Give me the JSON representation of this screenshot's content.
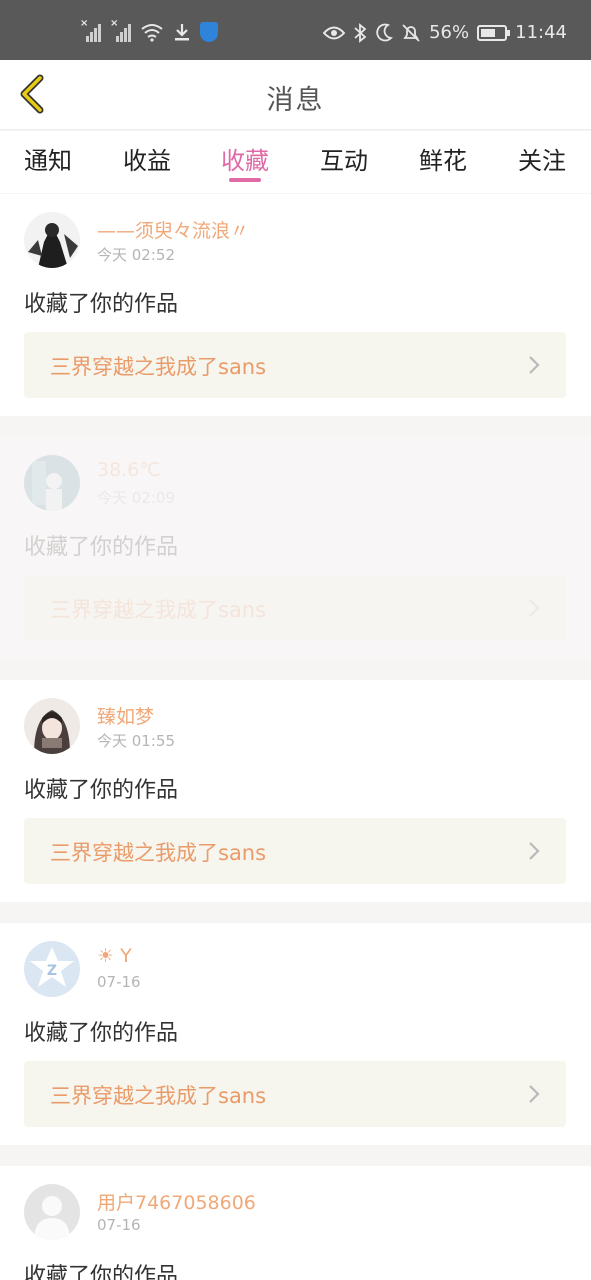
{
  "status_bar": {
    "battery": "56%",
    "time": "11:44",
    "icons": [
      "signal-1-icon",
      "signal-2-icon",
      "wifi-icon",
      "download-icon",
      "shield-icon",
      "eye-icon",
      "bluetooth-icon",
      "moon-icon",
      "bell-off-icon",
      "battery-icon"
    ]
  },
  "header": {
    "title": "消息",
    "back_icon": "chevron-left-icon",
    "accent": "#e0c400"
  },
  "tabs": [
    {
      "label": "通知"
    },
    {
      "label": "收益"
    },
    {
      "label": "收藏",
      "active": true
    },
    {
      "label": "互动"
    },
    {
      "label": "鲜花"
    },
    {
      "label": "关注"
    }
  ],
  "colors": {
    "accent": "#e06aa6",
    "username": "#f0a878",
    "work_title": "#ea9b6a",
    "work_bg": "#f6f5ee"
  },
  "items": [
    {
      "username": "——须臾々流浪〃",
      "time": "今天 02:52",
      "action": "收藏了你的作品",
      "work": "三界穿越之我成了sans"
    },
    {
      "username": "38.6℃",
      "time": "今天 02:09",
      "action": "收藏了你的作品",
      "work": "三界穿越之我成了sans"
    },
    {
      "username": "臻如梦",
      "time": "今天 01:55",
      "action": "收藏了你的作品",
      "work": "三界穿越之我成了sans"
    },
    {
      "username": "☀ Y",
      "time": "07-16",
      "action": "收藏了你的作品",
      "work": "三界穿越之我成了sans"
    },
    {
      "username": "用户7467058606",
      "time": "07-16",
      "action": "收藏了你的作品",
      "work": ""
    }
  ]
}
